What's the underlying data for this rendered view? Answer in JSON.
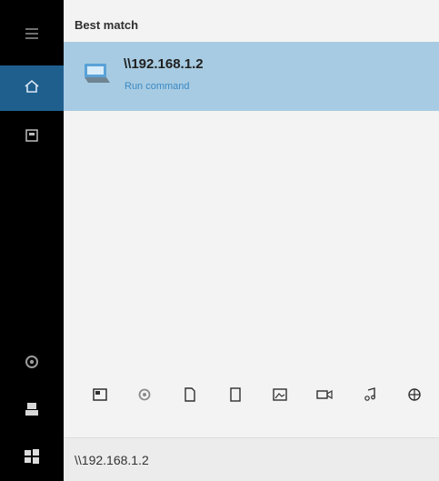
{
  "panel": {
    "section_label": "Best match",
    "best_match": {
      "title": "\\\\192.168.1.2",
      "subtitle": "Run command",
      "icon": "run-command-icon"
    }
  },
  "rail": {
    "items": [
      {
        "name": "hamburger-menu-icon"
      },
      {
        "name": "home-icon",
        "active": true
      },
      {
        "name": "documents-icon"
      },
      {
        "name": "settings-icon"
      },
      {
        "name": "user-icon"
      },
      {
        "name": "windows-start-icon"
      }
    ]
  },
  "filters": [
    {
      "name": "apps-filter-icon"
    },
    {
      "name": "settings-filter-icon"
    },
    {
      "name": "documents-filter-icon"
    },
    {
      "name": "folders-filter-icon"
    },
    {
      "name": "photos-filter-icon"
    },
    {
      "name": "videos-filter-icon"
    },
    {
      "name": "music-filter-icon"
    },
    {
      "name": "web-filter-icon"
    }
  ],
  "search": {
    "value": "\\\\192.168.1.2"
  },
  "colors": {
    "rail": "#000000",
    "rail_active": "#1f5f8e",
    "highlight": "#a7cbe2",
    "subtitle": "#3c89c4"
  }
}
